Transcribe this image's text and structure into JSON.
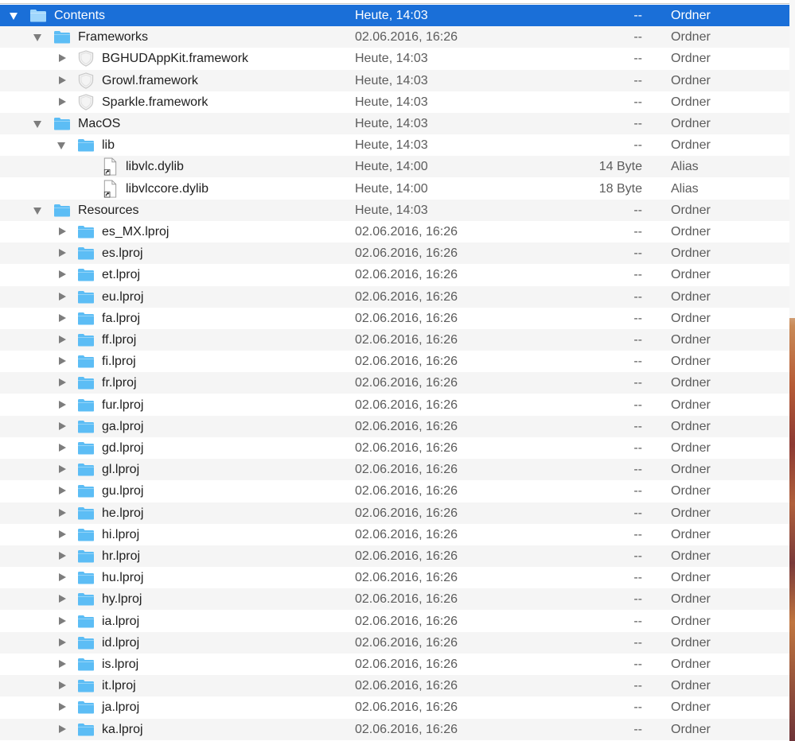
{
  "accent_color": "#1a6fd8",
  "folder_color": "#5cbdf5",
  "rows": [
    {
      "name": "Contents",
      "date": "Heute, 14:03",
      "size": "--",
      "kind": "Ordner",
      "icon": "folder-icon",
      "disclosure": "expanded",
      "depth": 0,
      "selected": true
    },
    {
      "name": "Frameworks",
      "date": "02.06.2016, 16:26",
      "size": "--",
      "kind": "Ordner",
      "icon": "folder-icon",
      "disclosure": "expanded",
      "depth": 1
    },
    {
      "name": "BGHUDAppKit.framework",
      "date": "Heute, 14:03",
      "size": "--",
      "kind": "Ordner",
      "icon": "framework-shield-icon",
      "disclosure": "collapsed",
      "depth": 2
    },
    {
      "name": "Growl.framework",
      "date": "Heute, 14:03",
      "size": "--",
      "kind": "Ordner",
      "icon": "framework-shield-icon",
      "disclosure": "collapsed",
      "depth": 2
    },
    {
      "name": "Sparkle.framework",
      "date": "Heute, 14:03",
      "size": "--",
      "kind": "Ordner",
      "icon": "framework-shield-icon",
      "disclosure": "collapsed",
      "depth": 2
    },
    {
      "name": "MacOS",
      "date": "Heute, 14:03",
      "size": "--",
      "kind": "Ordner",
      "icon": "folder-icon",
      "disclosure": "expanded",
      "depth": 1
    },
    {
      "name": "lib",
      "date": "Heute, 14:03",
      "size": "--",
      "kind": "Ordner",
      "icon": "folder-icon",
      "disclosure": "expanded",
      "depth": 2
    },
    {
      "name": "libvlc.dylib",
      "date": "Heute, 14:00",
      "size": "14 Byte",
      "kind": "Alias",
      "icon": "alias-document-icon",
      "disclosure": "none",
      "depth": 3
    },
    {
      "name": "libvlccore.dylib",
      "date": "Heute, 14:00",
      "size": "18 Byte",
      "kind": "Alias",
      "icon": "alias-document-icon",
      "disclosure": "none",
      "depth": 3
    },
    {
      "name": "Resources",
      "date": "Heute, 14:03",
      "size": "--",
      "kind": "Ordner",
      "icon": "folder-icon",
      "disclosure": "expanded",
      "depth": 1
    },
    {
      "name": "es_MX.lproj",
      "date": "02.06.2016, 16:26",
      "size": "--",
      "kind": "Ordner",
      "icon": "folder-icon",
      "disclosure": "collapsed",
      "depth": 2
    },
    {
      "name": "es.lproj",
      "date": "02.06.2016, 16:26",
      "size": "--",
      "kind": "Ordner",
      "icon": "folder-icon",
      "disclosure": "collapsed",
      "depth": 2
    },
    {
      "name": "et.lproj",
      "date": "02.06.2016, 16:26",
      "size": "--",
      "kind": "Ordner",
      "icon": "folder-icon",
      "disclosure": "collapsed",
      "depth": 2
    },
    {
      "name": "eu.lproj",
      "date": "02.06.2016, 16:26",
      "size": "--",
      "kind": "Ordner",
      "icon": "folder-icon",
      "disclosure": "collapsed",
      "depth": 2
    },
    {
      "name": "fa.lproj",
      "date": "02.06.2016, 16:26",
      "size": "--",
      "kind": "Ordner",
      "icon": "folder-icon",
      "disclosure": "collapsed",
      "depth": 2
    },
    {
      "name": "ff.lproj",
      "date": "02.06.2016, 16:26",
      "size": "--",
      "kind": "Ordner",
      "icon": "folder-icon",
      "disclosure": "collapsed",
      "depth": 2
    },
    {
      "name": "fi.lproj",
      "date": "02.06.2016, 16:26",
      "size": "--",
      "kind": "Ordner",
      "icon": "folder-icon",
      "disclosure": "collapsed",
      "depth": 2
    },
    {
      "name": "fr.lproj",
      "date": "02.06.2016, 16:26",
      "size": "--",
      "kind": "Ordner",
      "icon": "folder-icon",
      "disclosure": "collapsed",
      "depth": 2
    },
    {
      "name": "fur.lproj",
      "date": "02.06.2016, 16:26",
      "size": "--",
      "kind": "Ordner",
      "icon": "folder-icon",
      "disclosure": "collapsed",
      "depth": 2
    },
    {
      "name": "ga.lproj",
      "date": "02.06.2016, 16:26",
      "size": "--",
      "kind": "Ordner",
      "icon": "folder-icon",
      "disclosure": "collapsed",
      "depth": 2
    },
    {
      "name": "gd.lproj",
      "date": "02.06.2016, 16:26",
      "size": "--",
      "kind": "Ordner",
      "icon": "folder-icon",
      "disclosure": "collapsed",
      "depth": 2
    },
    {
      "name": "gl.lproj",
      "date": "02.06.2016, 16:26",
      "size": "--",
      "kind": "Ordner",
      "icon": "folder-icon",
      "disclosure": "collapsed",
      "depth": 2
    },
    {
      "name": "gu.lproj",
      "date": "02.06.2016, 16:26",
      "size": "--",
      "kind": "Ordner",
      "icon": "folder-icon",
      "disclosure": "collapsed",
      "depth": 2
    },
    {
      "name": "he.lproj",
      "date": "02.06.2016, 16:26",
      "size": "--",
      "kind": "Ordner",
      "icon": "folder-icon",
      "disclosure": "collapsed",
      "depth": 2
    },
    {
      "name": "hi.lproj",
      "date": "02.06.2016, 16:26",
      "size": "--",
      "kind": "Ordner",
      "icon": "folder-icon",
      "disclosure": "collapsed",
      "depth": 2
    },
    {
      "name": "hr.lproj",
      "date": "02.06.2016, 16:26",
      "size": "--",
      "kind": "Ordner",
      "icon": "folder-icon",
      "disclosure": "collapsed",
      "depth": 2
    },
    {
      "name": "hu.lproj",
      "date": "02.06.2016, 16:26",
      "size": "--",
      "kind": "Ordner",
      "icon": "folder-icon",
      "disclosure": "collapsed",
      "depth": 2
    },
    {
      "name": "hy.lproj",
      "date": "02.06.2016, 16:26",
      "size": "--",
      "kind": "Ordner",
      "icon": "folder-icon",
      "disclosure": "collapsed",
      "depth": 2
    },
    {
      "name": "ia.lproj",
      "date": "02.06.2016, 16:26",
      "size": "--",
      "kind": "Ordner",
      "icon": "folder-icon",
      "disclosure": "collapsed",
      "depth": 2
    },
    {
      "name": "id.lproj",
      "date": "02.06.2016, 16:26",
      "size": "--",
      "kind": "Ordner",
      "icon": "folder-icon",
      "disclosure": "collapsed",
      "depth": 2
    },
    {
      "name": "is.lproj",
      "date": "02.06.2016, 16:26",
      "size": "--",
      "kind": "Ordner",
      "icon": "folder-icon",
      "disclosure": "collapsed",
      "depth": 2
    },
    {
      "name": "it.lproj",
      "date": "02.06.2016, 16:26",
      "size": "--",
      "kind": "Ordner",
      "icon": "folder-icon",
      "disclosure": "collapsed",
      "depth": 2
    },
    {
      "name": "ja.lproj",
      "date": "02.06.2016, 16:26",
      "size": "--",
      "kind": "Ordner",
      "icon": "folder-icon",
      "disclosure": "collapsed",
      "depth": 2
    },
    {
      "name": "ka.lproj",
      "date": "02.06.2016, 16:26",
      "size": "--",
      "kind": "Ordner",
      "icon": "folder-icon",
      "disclosure": "collapsed",
      "depth": 2
    }
  ]
}
